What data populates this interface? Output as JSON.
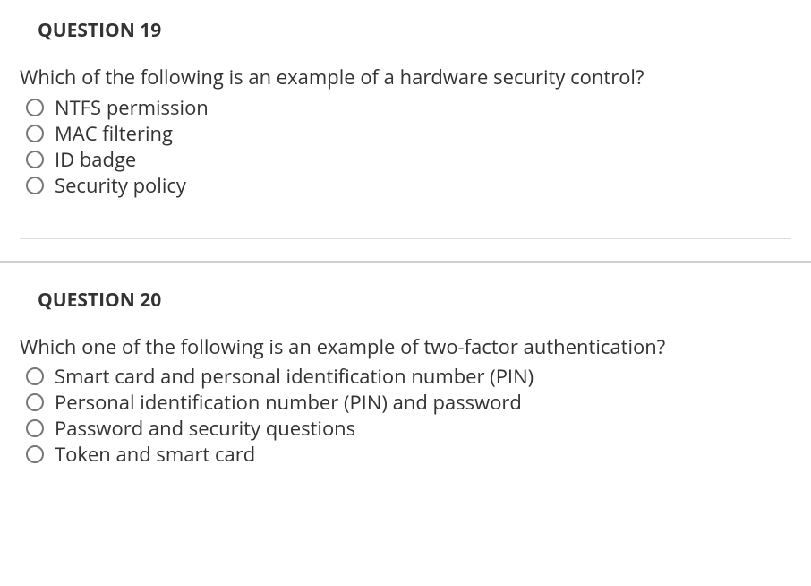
{
  "questions": [
    {
      "heading": "QUESTION 19",
      "prompt": "Which of the following is an example of a hardware security control?",
      "options": [
        "NTFS permission",
        "MAC filtering",
        "ID badge",
        "Security policy"
      ]
    },
    {
      "heading": "QUESTION 20",
      "prompt": "Which one of the following is an example of two-factor authentication?",
      "options": [
        "Smart card and personal identification number (PIN)",
        "Personal identification number (PIN) and password",
        "Password and security questions",
        "Token and smart card"
      ]
    }
  ]
}
